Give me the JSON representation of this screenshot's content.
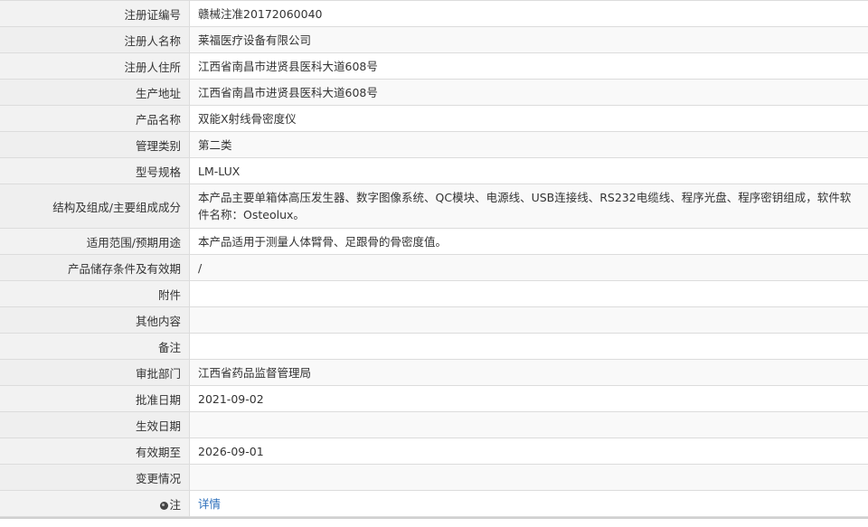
{
  "rows": [
    {
      "label": "注册证编号",
      "value": "赣械注准20172060040"
    },
    {
      "label": "注册人名称",
      "value": "莱福医疗设备有限公司"
    },
    {
      "label": "注册人住所",
      "value": "江西省南昌市进贤县医科大道608号"
    },
    {
      "label": "生产地址",
      "value": "江西省南昌市进贤县医科大道608号"
    },
    {
      "label": "产品名称",
      "value": "双能X射线骨密度仪"
    },
    {
      "label": "管理类别",
      "value": "第二类"
    },
    {
      "label": "型号规格",
      "value": "LM-LUX"
    },
    {
      "label": "结构及组成/主要组成成分",
      "value": "本产品主要单箱体高压发生器、数字图像系统、QC模块、电源线、USB连接线、RS232电缆线、程序光盘、程序密钥组成，软件软件名称：Osteolux。"
    },
    {
      "label": "适用范围/预期用途",
      "value": "本产品适用于测量人体臂骨、足跟骨的骨密度值。"
    },
    {
      "label": "产品储存条件及有效期",
      "value": "/"
    },
    {
      "label": "附件",
      "value": ""
    },
    {
      "label": "其他内容",
      "value": ""
    },
    {
      "label": "备注",
      "value": ""
    },
    {
      "label": "审批部门",
      "value": "江西省药品监督管理局"
    },
    {
      "label": "批准日期",
      "value": "2021-09-02"
    },
    {
      "label": "生效日期",
      "value": ""
    },
    {
      "label": "有效期至",
      "value": "2026-09-01"
    },
    {
      "label": "变更情况",
      "value": ""
    }
  ],
  "note": {
    "label": "注",
    "icon": "info-icon",
    "link_text": "详情"
  },
  "colors": {
    "label_bg": "#f2f2f2",
    "border": "#dcdcdc",
    "link": "#2a6ebb",
    "text": "#333333"
  }
}
